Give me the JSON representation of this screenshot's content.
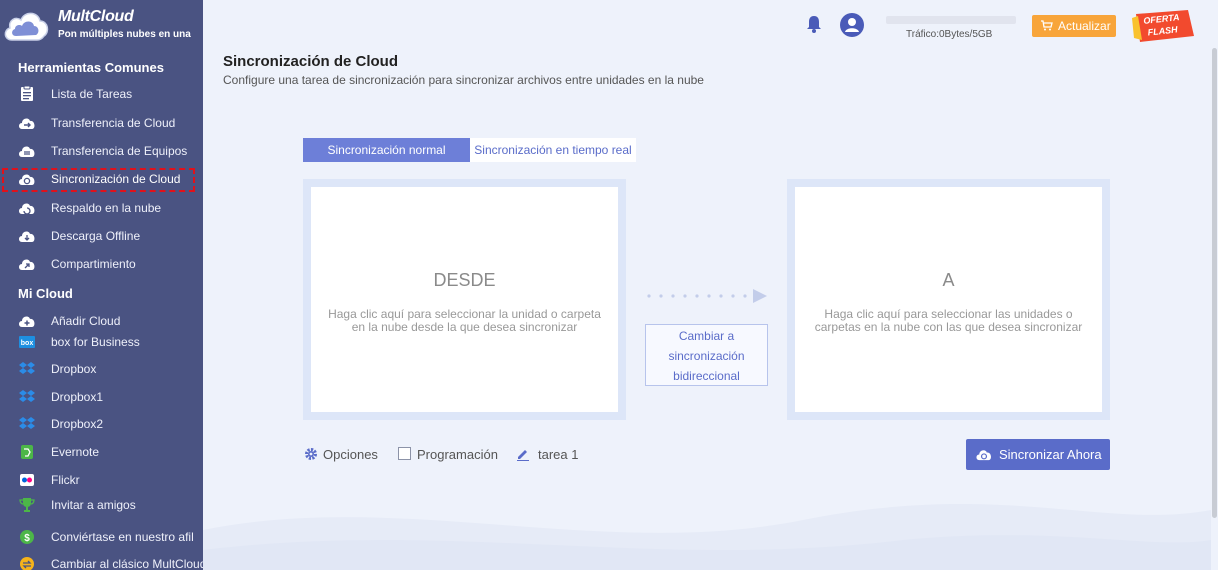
{
  "brand": {
    "name": "MultCloud",
    "tagline": "Pon múltiples nubes en una"
  },
  "sidebar": {
    "common_title": "Herramientas Comunes",
    "common_items": [
      {
        "label": "Lista de Tareas",
        "icon": "task-list-icon"
      },
      {
        "label": "Transferencia de Cloud",
        "icon": "cloud-transfer-icon"
      },
      {
        "label": "Transferencia de Equipos",
        "icon": "team-transfer-icon"
      },
      {
        "label": "Sincronización de Cloud",
        "icon": "cloud-sync-icon",
        "active": true
      },
      {
        "label": "Respaldo en la nube",
        "icon": "cloud-backup-icon"
      },
      {
        "label": "Descarga Offline",
        "icon": "offline-download-icon"
      },
      {
        "label": "Compartimiento",
        "icon": "share-icon"
      }
    ],
    "mycloud_title": "Mi Cloud",
    "mycloud_items": [
      {
        "label": "Añadir Cloud",
        "icon": "add-cloud-icon"
      },
      {
        "label": "box for Business",
        "icon": "box-icon"
      },
      {
        "label": "Dropbox",
        "icon": "dropbox-icon"
      },
      {
        "label": "Dropbox1",
        "icon": "dropbox-icon"
      },
      {
        "label": "Dropbox2",
        "icon": "dropbox-icon"
      },
      {
        "label": "Evernote",
        "icon": "evernote-icon"
      },
      {
        "label": "Flickr",
        "icon": "flickr-icon"
      }
    ],
    "bottom_items": [
      {
        "label": "Invitar a amigos",
        "icon": "trophy-icon"
      },
      {
        "label": "Conviértase en nuestro afil",
        "icon": "dollar-icon"
      },
      {
        "label": "Cambiar al clásico MultCloud",
        "icon": "switch-icon"
      }
    ]
  },
  "topbar": {
    "traffic_label": "Tráfico:0Bytes/5GB",
    "traffic_used_fraction": 0,
    "upgrade_label": "Actualizar",
    "flash_line1": "OFERTA",
    "flash_line2": "FLASH"
  },
  "main": {
    "title": "Sincronización de Cloud",
    "subtitle": "Configure una tarea de sincronización para sincronizar archivos entre unidades en la nube",
    "tabs": [
      {
        "label": "Sincronización normal",
        "selected": true
      },
      {
        "label": "Sincronización en tiempo real",
        "selected": false
      }
    ],
    "from_box": {
      "title": "DESDE",
      "desc": "Haga clic aquí para seleccionar la unidad o carpeta en la nube desde la que desea sincronizar"
    },
    "to_box": {
      "title": "A",
      "desc": "Haga clic aquí para seleccionar las unidades o carpetas en la nube con las que desea sincronizar"
    },
    "bidi_button": {
      "line1": "Cambiar a",
      "line2": "sincronización",
      "line3": "bidireccional"
    },
    "options_label": "Opciones",
    "schedule_label": "Programación",
    "task_name": "tarea 1",
    "sync_now_label": "Sincronizar Ahora"
  },
  "colors": {
    "sidebar_bg": "#4a5382",
    "accent": "#5a6cc9",
    "upgrade": "#f8a53a",
    "active_outline": "#e0111b"
  }
}
